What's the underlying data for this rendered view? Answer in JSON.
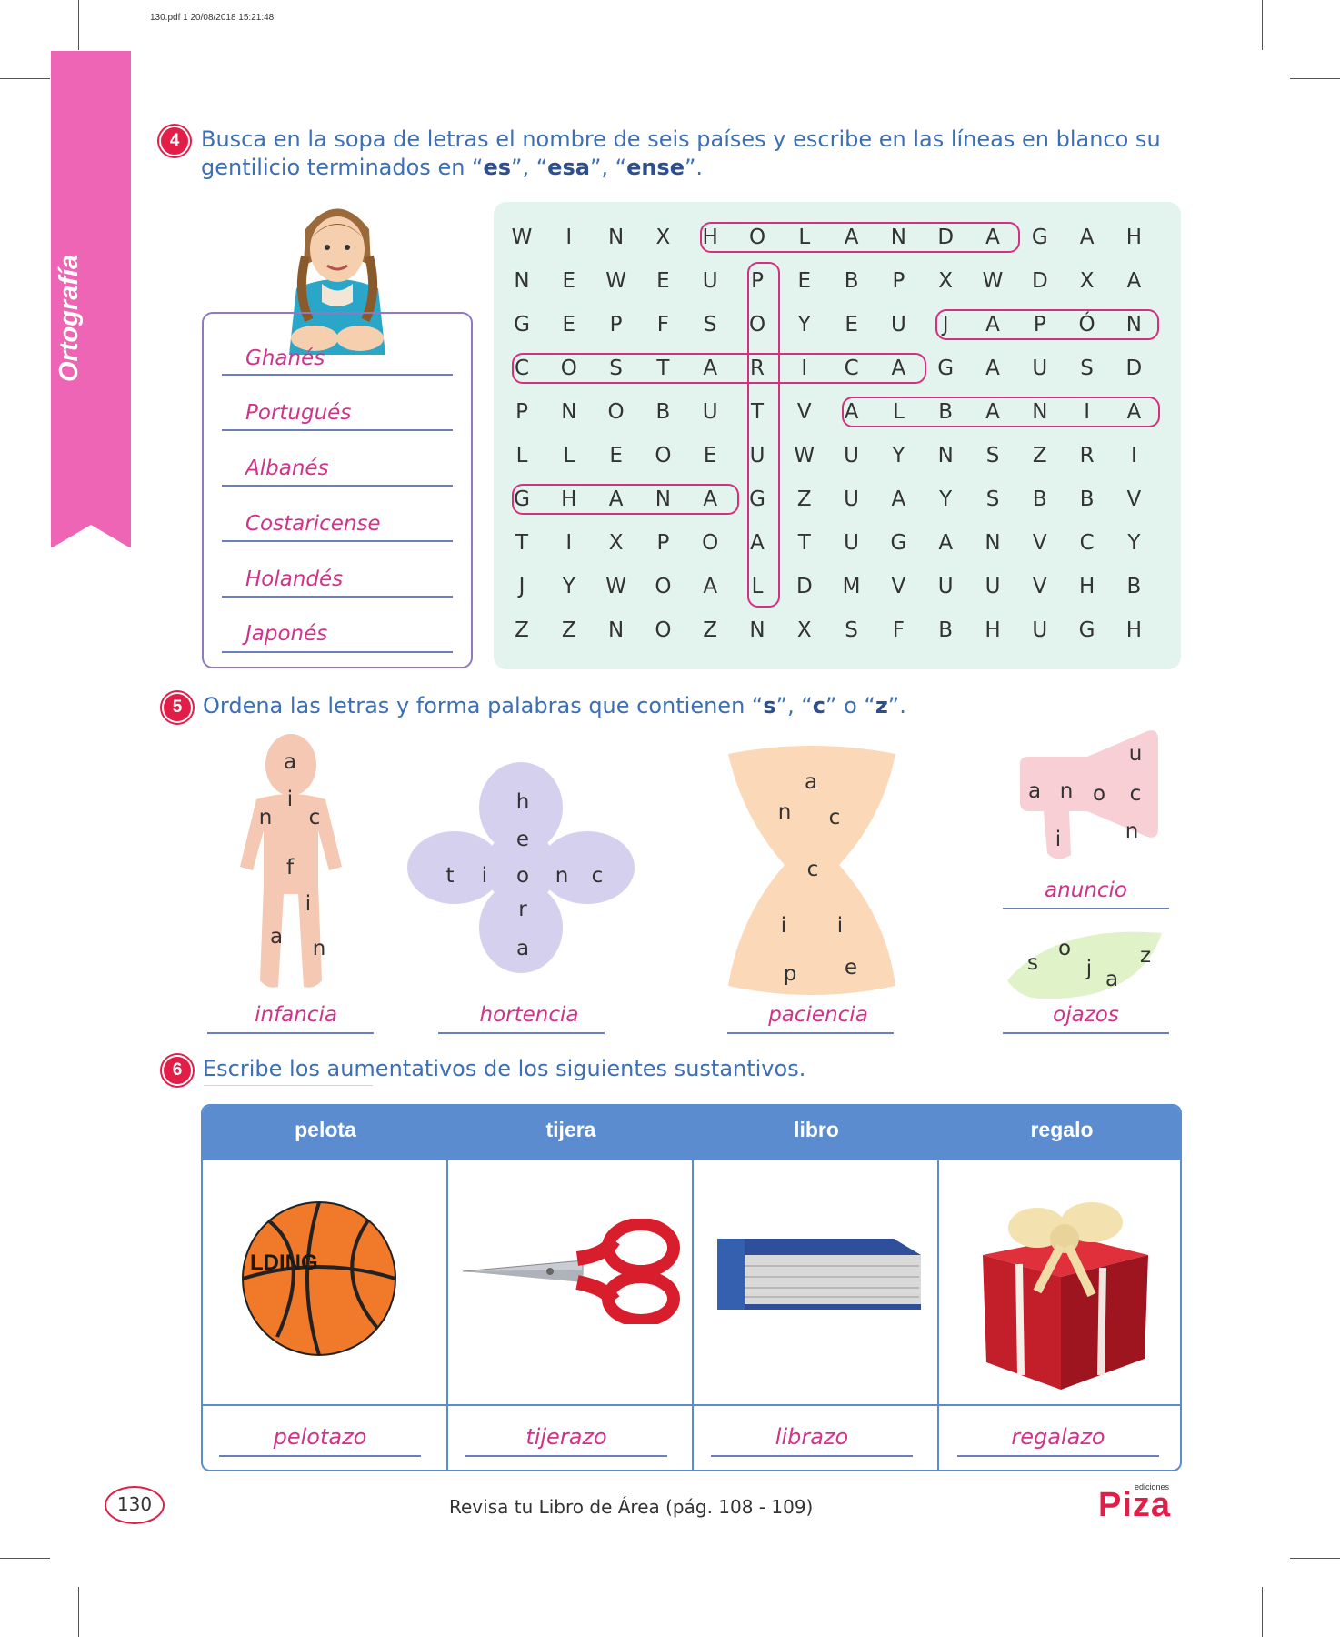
{
  "print_meta": "130.pdf   1   20/08/2018   15:21:48",
  "side_label": "Ortografía",
  "ex4": {
    "number": "4",
    "instruction_1": "Busca en la sopa de letras el nombre de seis países y escribe en las líneas en blanco su",
    "instruction_2a": "gentilicio terminados en “",
    "instruction_2b": "es",
    "instruction_2c": "”, “",
    "instruction_2d": "esa",
    "instruction_2e": "”, “",
    "instruction_2f": "ense",
    "instruction_2g": "”.",
    "answers": [
      "Ghanés",
      "Portugués",
      "Albanés",
      "Costaricense",
      "Holandés",
      "Japonés"
    ],
    "grid": [
      [
        "W",
        "I",
        "N",
        "X",
        "H",
        "O",
        "L",
        "A",
        "N",
        "D",
        "A",
        "G",
        "A",
        "H"
      ],
      [
        "N",
        "E",
        "W",
        "E",
        "U",
        "P",
        "E",
        "B",
        "P",
        "X",
        "W",
        "D",
        "X",
        "A"
      ],
      [
        "G",
        "E",
        "P",
        "F",
        "S",
        "O",
        "Y",
        "E",
        "U",
        "J",
        "A",
        "P",
        "Ó",
        "N"
      ],
      [
        "C",
        "O",
        "S",
        "T",
        "A",
        "R",
        "I",
        "C",
        "A",
        "G",
        "A",
        "U",
        "S",
        "D"
      ],
      [
        "P",
        "N",
        "O",
        "B",
        "U",
        "T",
        "V",
        "A",
        "L",
        "B",
        "A",
        "N",
        "I",
        "A"
      ],
      [
        "L",
        "L",
        "E",
        "O",
        "E",
        "U",
        "W",
        "U",
        "Y",
        "N",
        "S",
        "Z",
        "R",
        "I"
      ],
      [
        "G",
        "H",
        "A",
        "N",
        "A",
        "G",
        "Z",
        "U",
        "A",
        "Y",
        "S",
        "B",
        "B",
        "V"
      ],
      [
        "T",
        "I",
        "X",
        "P",
        "O",
        "A",
        "T",
        "U",
        "G",
        "A",
        "N",
        "V",
        "C",
        "Y"
      ],
      [
        "J",
        "Y",
        "W",
        "O",
        "A",
        "L",
        "D",
        "M",
        "V",
        "U",
        "U",
        "V",
        "H",
        "B"
      ],
      [
        "Z",
        "Z",
        "N",
        "O",
        "Z",
        "N",
        "X",
        "S",
        "F",
        "B",
        "H",
        "U",
        "G",
        "H"
      ]
    ]
  },
  "ex5": {
    "number": "5",
    "instruction_a": "Ordena las letras y forma palabras que contienen “",
    "instruction_s": "s",
    "instruction_b": "”, “",
    "instruction_c": "c",
    "instruction_d": "” o “",
    "instruction_z": "z",
    "instruction_e": "”.",
    "answers": [
      "infancia",
      "hortencia",
      "paciencia",
      "anuncio",
      "ojazos"
    ]
  },
  "ex6": {
    "number": "6",
    "instruction": "Escribe los aumentativos de los siguientes sustantivos.",
    "headers": [
      "pelota",
      "tijera",
      "libro",
      "regalo"
    ],
    "answers": [
      "pelotazo",
      "tijerazo",
      "librazo",
      "regalazo"
    ],
    "ball_text": "LDING"
  },
  "footer": {
    "page": "130",
    "note": "Revisa tu Libro de Área (pág. 108 - 109)",
    "logo_small": "ediciones",
    "logo": "Piza"
  },
  "colors": {
    "accent_pink": "#ef65b5",
    "answer_magenta": "#d0338a",
    "blue_text": "#3c6fb6",
    "table_blue": "#5b8cd0",
    "grid_bg": "#e3f3ee"
  }
}
